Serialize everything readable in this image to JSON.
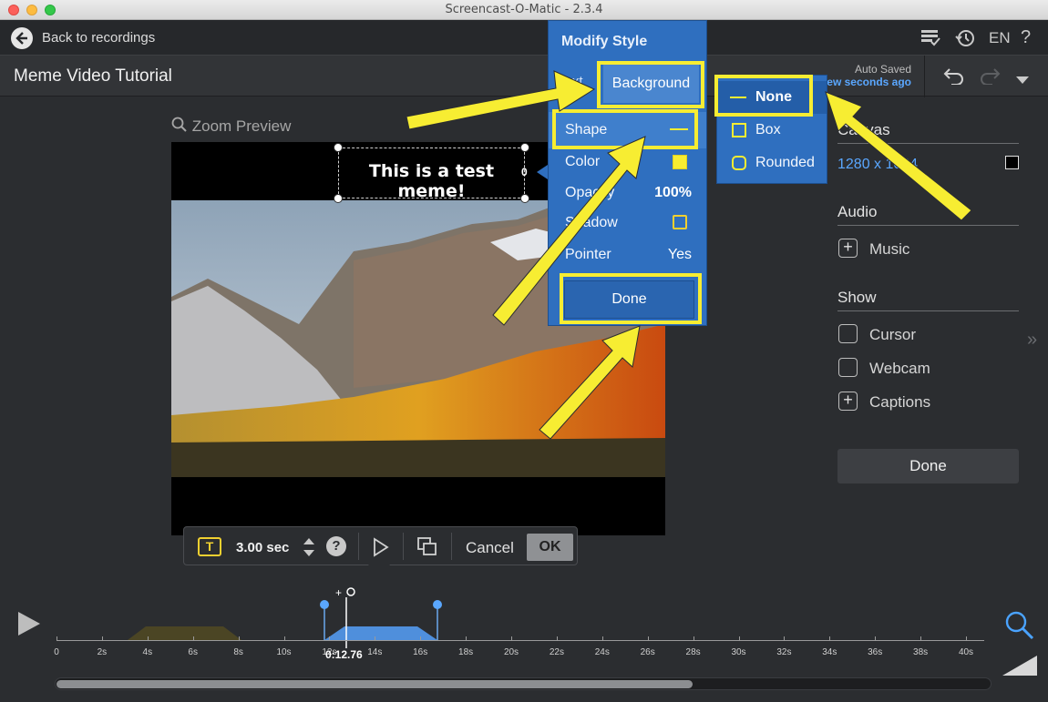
{
  "window": {
    "title": "Screencast-O-Matic - 2.3.4"
  },
  "topnav": {
    "back_label": "Back to recordings",
    "language": "EN"
  },
  "header": {
    "project_title": "Meme Video Tutorial",
    "autosaved_label": "Auto Saved",
    "autosaved_time": "few seconds ago"
  },
  "preview": {
    "zoom_label": "Zoom Preview",
    "meme_text": "This is a test meme!",
    "meme_suffix": "0"
  },
  "modify_style": {
    "title": "Modify Style",
    "tab_text": "Text",
    "tab_background": "Background",
    "rows": [
      {
        "label": "Shape",
        "value": "—"
      },
      {
        "label": "Color",
        "value": ""
      },
      {
        "label": "Opacity",
        "value": "100%"
      },
      {
        "label": "Shadow",
        "value": ""
      },
      {
        "label": "Pointer",
        "value": "Yes"
      }
    ],
    "done_label": "Done"
  },
  "shape_menu": {
    "options": [
      "None",
      "Box",
      "Rounded"
    ],
    "selected": "None"
  },
  "right_panel": {
    "canvas_heading": "Canvas",
    "canvas_size": "1280 x 1024",
    "audio_heading": "Audio",
    "music_label": "Music",
    "show_heading": "Show",
    "cursor_label": "Cursor",
    "webcam_label": "Webcam",
    "captions_label": "Captions",
    "done_label": "Done"
  },
  "toolbar": {
    "duration": "3.00 sec",
    "cancel_label": "Cancel",
    "ok_label": "OK",
    "text_icon_label": "T"
  },
  "timeline": {
    "playhead_time": "0:12.76",
    "ticks": [
      "0",
      "2s",
      "4s",
      "6s",
      "8s",
      "10s",
      "12s",
      "14s",
      "16s",
      "18s",
      "20s",
      "22s",
      "24s",
      "26s",
      "28s",
      "30s",
      "32s",
      "34s",
      "36s",
      "38s",
      "40s"
    ],
    "scroll_fraction": 0.68
  },
  "colors": {
    "accent_blue": "#2f6fbf",
    "highlight_yellow": "#f7ed32",
    "link_blue": "#5aa7ff"
  }
}
